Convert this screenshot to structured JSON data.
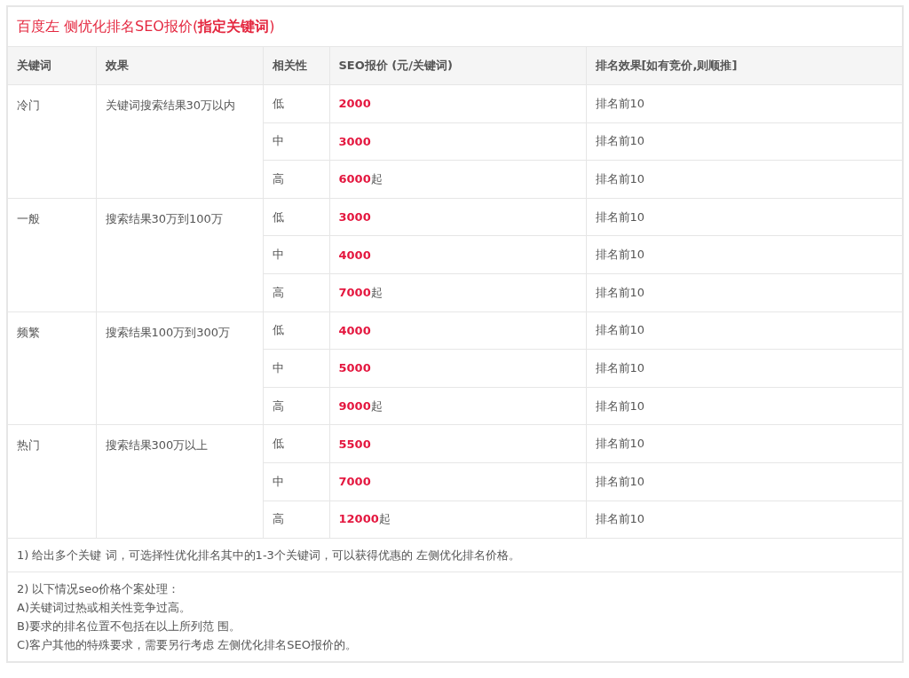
{
  "title": "百度左 侧优化排名SEO报价(**指定关键词**)",
  "table": {
    "columns": [
      "关键词",
      "效果",
      "相关性",
      "SEO报价 (元/关键词)",
      "排名效果[如有竞价,则顺推]"
    ],
    "groups": [
      {
        "keyword": "冷门",
        "effect": "关键词搜索结果30万以内",
        "tiers": [
          {
            "relevance": "低",
            "amount": "2000",
            "result": "排名前10"
          },
          {
            "relevance": "中",
            "amount": "3000",
            "result": "排名前10"
          },
          {
            "relevance": "高",
            "amount": "6000",
            "suffix": "起",
            "result": "排名前10"
          }
        ]
      },
      {
        "keyword": "一般",
        "effect": "搜索结果30万到100万",
        "tiers": [
          {
            "relevance": "低",
            "amount": "3000",
            "result": "排名前10"
          },
          {
            "relevance": "中",
            "amount": "4000",
            "result": "排名前10"
          },
          {
            "relevance": "高",
            "amount": "7000",
            "suffix": "起",
            "result": "排名前10"
          }
        ]
      },
      {
        "keyword": "频繁",
        "effect": "搜索结果100万到300万",
        "tiers": [
          {
            "relevance": "低",
            "amount": "4000",
            "result": "排名前10"
          },
          {
            "relevance": "中",
            "amount": "5000",
            "result": "排名前10"
          },
          {
            "relevance": "高",
            "amount": "9000",
            "suffix": "起",
            "result": "排名前10"
          }
        ]
      },
      {
        "keyword": "热门",
        "effect": "搜索结果300万以上",
        "tiers": [
          {
            "relevance": "低",
            "amount": "5500",
            "result": "排名前10"
          },
          {
            "relevance": "中",
            "amount": "7000",
            "result": "排名前10"
          },
          {
            "relevance": "高",
            "amount": "12000",
            "suffix": "起",
            "result": "排名前10"
          }
        ]
      }
    ]
  },
  "notes": [
    [
      "1) 给出多个关键 词，可选择性优化排名其中的1-3个关键词，可以获得优惠的 左侧优化排名价格。"
    ],
    [
      "2) 以下情况seo价格个案处理：",
      "A)关键词过热或相关性竞争过高。",
      "B)要求的排名位置不包括在以上所列范 围。",
      "C)客户其他的特殊要求，需要另行考虑 左侧优化排名SEO报价的。"
    ]
  ]
}
